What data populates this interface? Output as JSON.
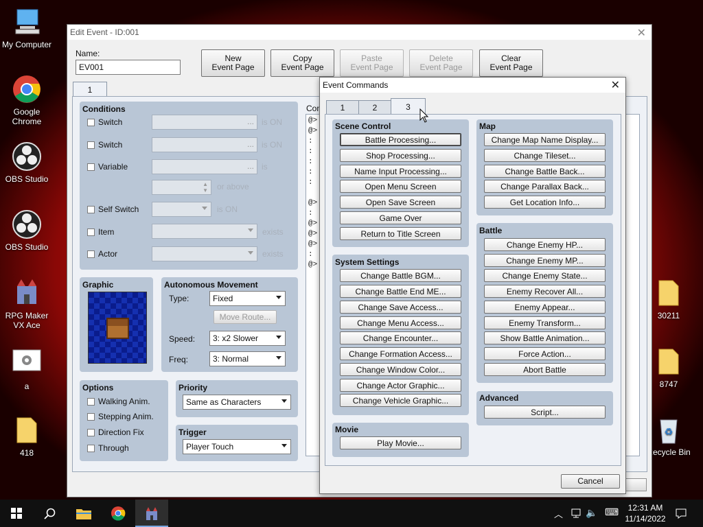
{
  "desktop": {
    "icons_left": [
      "My Computer",
      "Google Chrome",
      "OBS Studio",
      "OBS Studio",
      "RPG Maker VX Ace",
      "a",
      "418"
    ],
    "icons_right": [
      "30211",
      "8747",
      "Recycle Bin"
    ]
  },
  "edit_event": {
    "title": "Edit Event - ID:001",
    "name_label": "Name:",
    "name_value": "EV001",
    "buttons": {
      "new": [
        "New",
        "Event Page"
      ],
      "copy": [
        "Copy",
        "Event Page"
      ],
      "paste": [
        "Paste",
        "Event Page"
      ],
      "delete": [
        "Delete",
        "Event Page"
      ],
      "clear": [
        "Clear",
        "Event Page"
      ]
    },
    "page_tab": "1",
    "conditions": {
      "title": "Conditions",
      "switch1": "Switch",
      "switch2": "Switch",
      "variable": "Variable",
      "self_switch": "Self Switch",
      "item": "Item",
      "actor": "Actor",
      "is_on": "is ON",
      "is": "is",
      "or_above": "or above",
      "exists": "exists",
      "dots": "..."
    },
    "graphic_title": "Graphic",
    "autonomous": {
      "title": "Autonomous Movement",
      "type_label": "Type:",
      "type_value": "Fixed",
      "move_route": "Move Route...",
      "speed_label": "Speed:",
      "speed_value": "3: x2 Slower",
      "freq_label": "Freq:",
      "freq_value": "3: Normal"
    },
    "options": {
      "title": "Options",
      "walking": "Walking Anim.",
      "stepping": "Stepping Anim.",
      "direction_fix": "Direction Fix",
      "through": "Through"
    },
    "priority": {
      "title": "Priority",
      "value": "Same as Characters"
    },
    "trigger": {
      "title": "Trigger",
      "value": "Player Touch"
    },
    "contents_label": "Con",
    "contents_lines": [
      "@>",
      "@>",
      ":",
      ":",
      ":",
      ":",
      ":",
      "@>",
      ":",
      "@>",
      "@>",
      "@>",
      ":",
      "@>"
    ]
  },
  "event_commands": {
    "title": "Event Commands",
    "tabs": [
      "1",
      "2",
      "3"
    ],
    "scene_control": {
      "title": "Scene Control",
      "items": [
        "Battle Processing...",
        "Shop Processing...",
        "Name Input Processing...",
        "Open Menu Screen",
        "Open Save Screen",
        "Game Over",
        "Return to Title Screen"
      ]
    },
    "system_settings": {
      "title": "System Settings",
      "items": [
        "Change Battle BGM...",
        "Change Battle End ME...",
        "Change Save Access...",
        "Change Menu Access...",
        "Change Encounter...",
        "Change Formation Access...",
        "Change Window Color...",
        "Change Actor Graphic...",
        "Change Vehicle Graphic..."
      ]
    },
    "movie": {
      "title": "Movie",
      "items": [
        "Play Movie..."
      ]
    },
    "map": {
      "title": "Map",
      "items": [
        "Change Map Name Display...",
        "Change Tileset...",
        "Change Battle Back...",
        "Change Parallax Back...",
        "Get Location Info..."
      ]
    },
    "battle": {
      "title": "Battle",
      "items": [
        "Change Enemy HP...",
        "Change Enemy MP...",
        "Change Enemy State...",
        "Enemy Recover All...",
        "Enemy Appear...",
        "Enemy Transform...",
        "Show Battle Animation...",
        "Force Action...",
        "Abort Battle"
      ]
    },
    "advanced": {
      "title": "Advanced",
      "items": [
        "Script..."
      ]
    },
    "cancel": "Cancel"
  },
  "taskbar": {
    "time": "12:31 AM",
    "date": "11/14/2022"
  }
}
